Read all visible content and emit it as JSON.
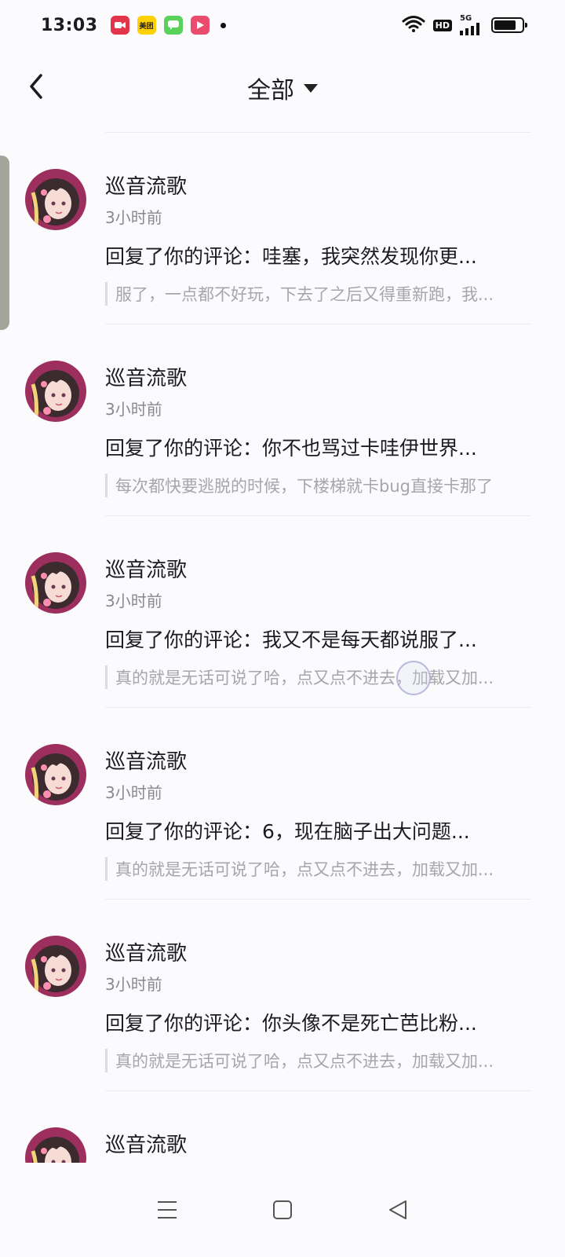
{
  "status_bar": {
    "time": "13:03",
    "notification_icons": [
      {
        "name": "video-app-icon",
        "color": "#e3344a",
        "label": ""
      },
      {
        "name": "meituan-app-icon",
        "color": "#ffd100",
        "label": "美团"
      },
      {
        "name": "messages-app-icon",
        "color": "#5ad15a",
        "label": ""
      },
      {
        "name": "video-player-app-icon",
        "color": "#e94c6c",
        "label": ""
      }
    ],
    "hd_label": "HD",
    "network_label": "5G"
  },
  "header": {
    "title": "全部"
  },
  "list": {
    "items": [
      {
        "username": "巡音流歌",
        "time": "3小时前",
        "reply": "回复了你的评论：哇塞，我突然发现你更...",
        "quote": "服了，一点都不好玩，下去了之后又得重新跑，我..."
      },
      {
        "username": "巡音流歌",
        "time": "3小时前",
        "reply": "回复了你的评论：你不也骂过卡哇伊世界...",
        "quote": "每次都快要逃脱的时候，下楼梯就卡bug直接卡那了"
      },
      {
        "username": "巡音流歌",
        "time": "3小时前",
        "reply": "回复了你的评论：我又不是每天都说服了...",
        "quote": "真的就是无话可说了哈，点又点不进去，加载又加..."
      },
      {
        "username": "巡音流歌",
        "time": "3小时前",
        "reply": "回复了你的评论：6，现在脑子出大问题...",
        "quote": "真的就是无话可说了哈，点又点不进去，加载又加..."
      },
      {
        "username": "巡音流歌",
        "time": "3小时前",
        "reply": "回复了你的评论：你头像不是死亡芭比粉...",
        "quote": "真的就是无话可说了哈，点又点不进去，加载又加..."
      },
      {
        "username": "巡音流歌",
        "time": "",
        "reply": "",
        "quote": ""
      }
    ]
  },
  "colors": {
    "background": "#fbfbfd",
    "text_primary": "#1c1c1e",
    "text_secondary": "#8a8a8e",
    "text_quote": "#a6a6ab"
  }
}
